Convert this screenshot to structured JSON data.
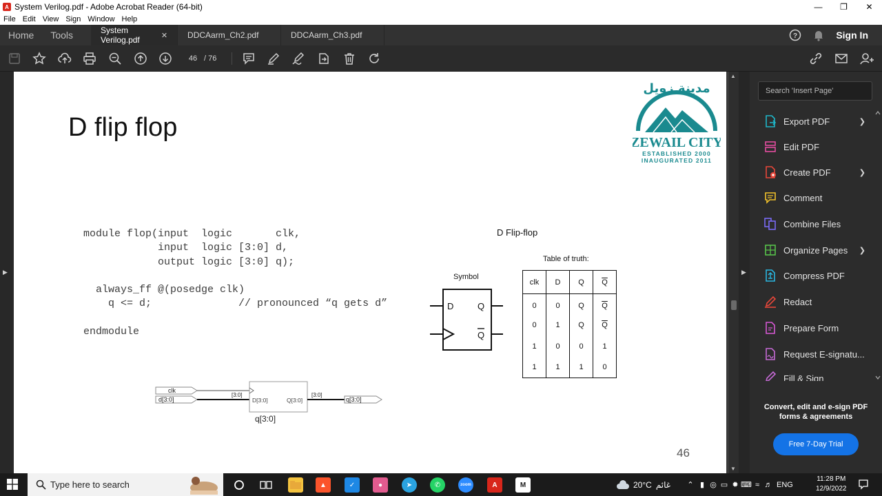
{
  "window": {
    "title": "System Verilog.pdf - Adobe Acrobat Reader (64-bit)"
  },
  "menu": [
    "File",
    "Edit",
    "View",
    "Sign",
    "Window",
    "Help"
  ],
  "tabs": {
    "home": "Home",
    "tools": "Tools",
    "documents": [
      "System Verilog.pdf",
      "DDCAarm_Ch2.pdf",
      "DDCAarm_Ch3.pdf"
    ],
    "sign_in": "Sign In"
  },
  "toolbar": {
    "current_page": "46",
    "page_total": "/ 76"
  },
  "page": {
    "title": "D flip flop",
    "code_lines": [
      "module flop(input  logic       clk,",
      "            input  logic [3:0] d,",
      "            output logic [3:0] q);",
      "",
      "  always_ff @(posedge clk)",
      "    q <= d;              // pronounced “q gets d”",
      "",
      "endmodule"
    ],
    "logo_arabic": "مدينة زويل",
    "logo_name": "ZEWAIL CITY",
    "logo_line1": "ESTABLISHED 2000",
    "logo_line2": "INAUGURATED 2011",
    "diagram_title": "D Flip-flop",
    "symbol_label": "Symbol",
    "symbol_d": "D",
    "symbol_q": "Q",
    "symbol_qbar": "Q",
    "truth_label": "Table of truth:",
    "truth_headers": [
      "clk",
      "D",
      "Q",
      "Q"
    ],
    "truth_rows": [
      [
        "0",
        "0",
        "Q",
        "Q"
      ],
      [
        "0",
        "1",
        "Q",
        "Q"
      ],
      [
        "1",
        "0",
        "0",
        "1"
      ],
      [
        "1",
        "1",
        "1",
        "0"
      ]
    ],
    "circuit": {
      "clk": "clk",
      "d_in": "d[3:0]",
      "bus1": "[3:0]",
      "d_port": "D[3:0]",
      "q_port": "Q[3:0]",
      "bus2": "[3:0]",
      "q_out": "q[3:0]",
      "caption": "q[3:0]"
    },
    "page_number": "46"
  },
  "right_panel": {
    "search_placeholder": "Search 'Insert Page'",
    "tools": [
      {
        "label": "Export PDF",
        "color": "#1fb7c9",
        "chevron": true
      },
      {
        "label": "Edit PDF",
        "color": "#e34da0",
        "chevron": false
      },
      {
        "label": "Create PDF",
        "color": "#e8473a",
        "chevron": true
      },
      {
        "label": "Comment",
        "color": "#f1c12b",
        "chevron": false
      },
      {
        "label": "Combine Files",
        "color": "#7b6cf6",
        "chevron": false
      },
      {
        "label": "Organize Pages",
        "color": "#58c24a",
        "chevron": true
      },
      {
        "label": "Compress PDF",
        "color": "#2ab6e0",
        "chevron": false
      },
      {
        "label": "Redact",
        "color": "#e8473a",
        "chevron": false
      },
      {
        "label": "Prepare Form",
        "color": "#d658d4",
        "chevron": false
      },
      {
        "label": "Request E-signatu...",
        "color": "#c66ad6",
        "chevron": false
      },
      {
        "label": "Fill & Sign",
        "color": "#c66ad6",
        "chevron": false
      }
    ],
    "promo": "Convert, edit and e-sign PDF forms & agreements",
    "trial_button": "Free 7-Day Trial"
  },
  "taskbar": {
    "search_placeholder": "Type here to search",
    "weather": "20°C",
    "weather_label": "غائم",
    "lang": "ENG",
    "time": "11:28 PM",
    "date": "12/9/2022",
    "app_zoom": "zoom"
  },
  "colors": {
    "accent_blue": "#1473e6",
    "logo_teal": "#1a8a8f"
  }
}
